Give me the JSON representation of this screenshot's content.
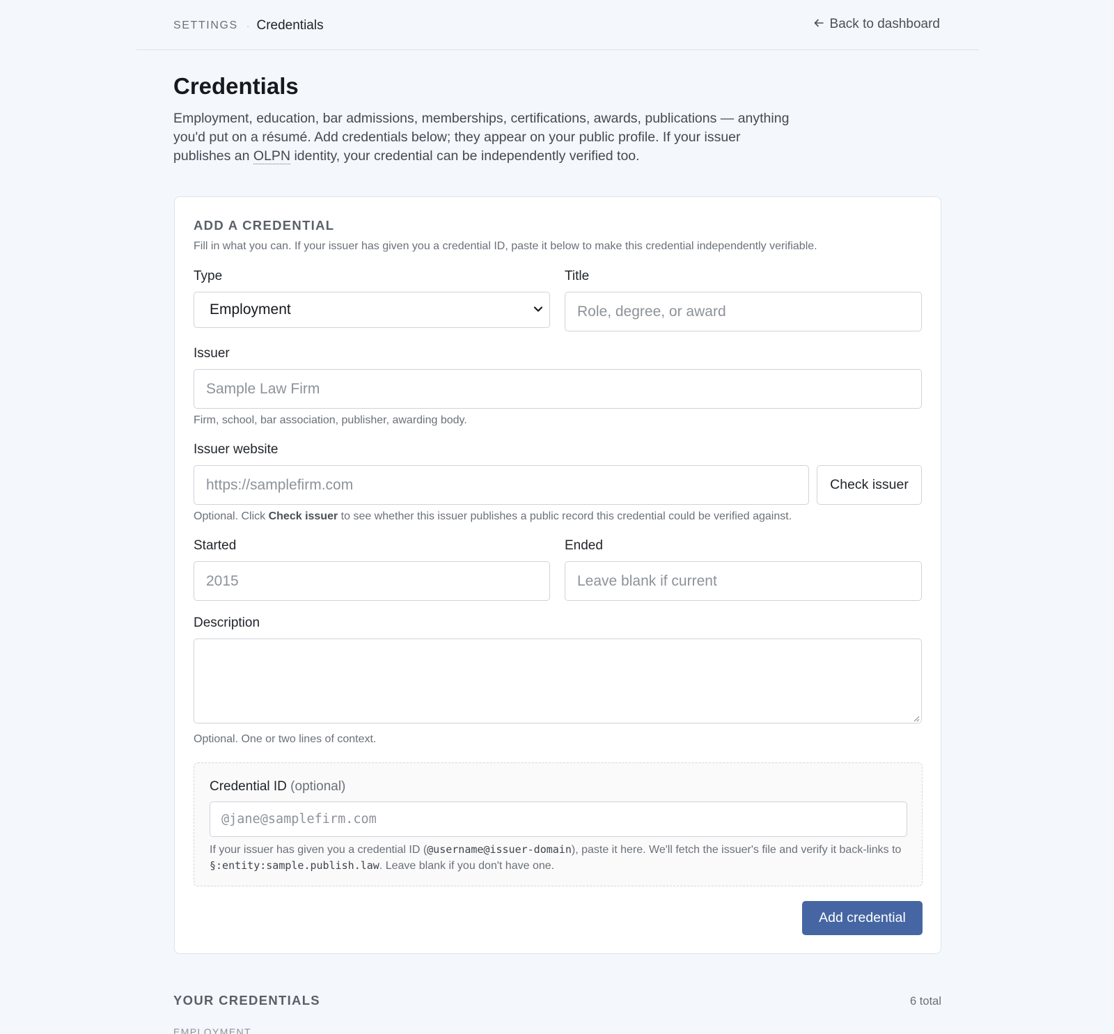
{
  "breadcrumb": {
    "root": "SETTINGS",
    "separator": "·",
    "current": "Credentials"
  },
  "back_link": {
    "icon": "arrow-left-icon",
    "label": "Back to dashboard"
  },
  "page": {
    "title": "Credentials",
    "intro_part1": "Employment, education, bar admissions, memberships, certifications, awards, publications — anything you'd put on a résumé. Add credentials below; they appear on your public profile. If your issuer publishes an ",
    "intro_abbr": "OLPN",
    "intro_part2": " identity, your credential can be independently verified too."
  },
  "add_form": {
    "heading": "ADD A CREDENTIAL",
    "subheading": "Fill in what you can. If your issuer has given you a credential ID, paste it below to make this credential independently verifiable.",
    "type": {
      "label": "Type",
      "value": "Employment"
    },
    "title": {
      "label": "Title",
      "placeholder": "Role, degree, or award"
    },
    "issuer": {
      "label": "Issuer",
      "placeholder": "Sample Law Firm",
      "help": "Firm, school, bar association, publisher, awarding body."
    },
    "issuer_website": {
      "label": "Issuer website",
      "placeholder": "https://samplefirm.com",
      "button": "Check issuer",
      "help_prefix": "Optional. Click ",
      "help_bold": "Check issuer",
      "help_suffix": " to see whether this issuer publishes a public record this credential could be verified against."
    },
    "started": {
      "label": "Started",
      "placeholder": "2015"
    },
    "ended": {
      "label": "Ended",
      "placeholder": "Leave blank if current"
    },
    "description": {
      "label": "Description",
      "value": "",
      "help": "Optional. One or two lines of context."
    },
    "credential_id": {
      "label": "Credential ID",
      "label_optional": "(optional)",
      "placeholder": "@jane@samplefirm.com",
      "help_1": "If your issuer has given you a credential ID (",
      "help_code_1": "@username@issuer-domain",
      "help_2": "), paste it here. We'll fetch the issuer's file and verify it back-links to ",
      "help_code_2": "§:entity:sample.publish.law",
      "help_3": ". Leave blank if you don't have one."
    },
    "submit": "Add credential"
  },
  "credentials_list": {
    "heading": "YOUR CREDENTIALS",
    "count": "6 total",
    "first_group": "EMPLOYMENT"
  },
  "colors": {
    "background": "#f4f7fc",
    "primary_button": "#4566a3",
    "card": "#ffffff"
  }
}
